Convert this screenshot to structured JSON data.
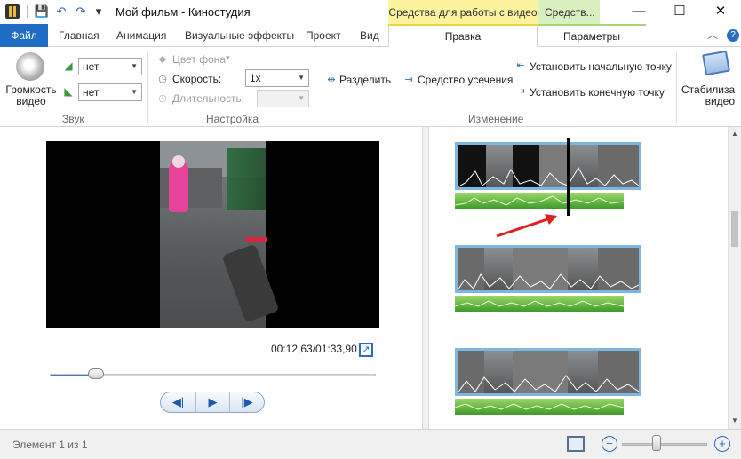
{
  "window": {
    "title": "Мой фильм - Киностудия",
    "context_tab_video": "Средства для работы с видео",
    "context_tab_media": "Средств...",
    "minimize": "—",
    "maximize": "☐",
    "close": "✕"
  },
  "quick_access": {
    "save": "💾",
    "undo": "↶",
    "redo": "↷",
    "dropdown": "▾"
  },
  "tabs": {
    "file": "Файл",
    "home": "Главная",
    "animation": "Анимация",
    "visual_effects": "Визуальные эффекты",
    "project": "Проект",
    "view": "Вид",
    "edit": "Правка",
    "parameters": "Параметры",
    "collapse": "︿",
    "help": "?"
  },
  "ribbon": {
    "sound": {
      "label": "Звук",
      "video_volume": "Громкость видео",
      "fade_in_value": "нет",
      "fade_out_value": "нет"
    },
    "settings": {
      "label": "Настройка",
      "bg_color": "Цвет фона",
      "bg_color_arrow": "▾",
      "speed": "Скорость:",
      "speed_value": "1x",
      "duration": "Длительность:",
      "duration_value": ""
    },
    "editing": {
      "label": "Изменение",
      "split": "Разделить",
      "trim_tool": "Средство усечения",
      "set_start": "Установить начальную точку",
      "set_end": "Установить конечную точку"
    },
    "stabilization": "Стабилиза видео"
  },
  "preview": {
    "timecode": "00:12,63/01:33,90",
    "seek_progress": 0.14,
    "prev_frame": "◀|",
    "play": "▶",
    "next_frame": "|▶"
  },
  "status": {
    "element_count": "Элемент 1 из 1"
  },
  "zoom": {
    "minus": "−",
    "plus": "+",
    "level": 0.37
  },
  "colors": {
    "file_tab": "#1e6cc4",
    "video_tools": "#fbf39d",
    "media_tools": "#d8f0c0",
    "clip_border": "#7fb6df",
    "audio": "#56b03a",
    "arrow": "#e02020"
  }
}
